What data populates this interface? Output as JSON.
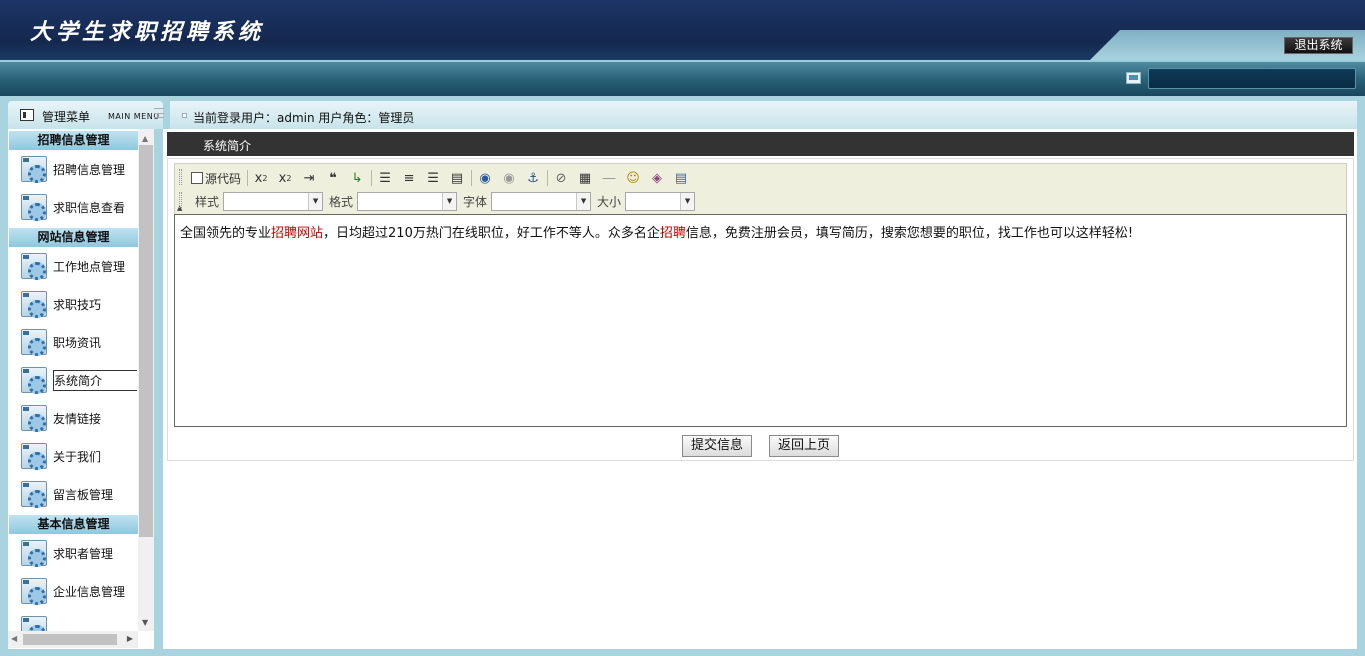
{
  "header": {
    "app_title": "大学生求职招聘系统",
    "logout_label": "退出系统"
  },
  "menu": {
    "title": "管理菜单",
    "subtitle": "MAIN MENU",
    "groups": [
      {
        "title": "招聘信息管理",
        "items": [
          {
            "label": "招聘信息管理",
            "icon": "gear-icon"
          },
          {
            "label": "求职信息查看",
            "icon": "gear-icon"
          }
        ]
      },
      {
        "title": "网站信息管理",
        "items": [
          {
            "label": "工作地点管理",
            "icon": "gear-icon"
          },
          {
            "label": "求职技巧",
            "icon": "gear-icon"
          },
          {
            "label": "职场资讯",
            "icon": "gear-icon"
          },
          {
            "label": "系统简介",
            "icon": "gear-icon",
            "active": true
          },
          {
            "label": "友情链接",
            "icon": "gear-icon"
          },
          {
            "label": "关于我们",
            "icon": "gear-icon"
          },
          {
            "label": "留言板管理",
            "icon": "gear-icon"
          }
        ]
      },
      {
        "title": "基本信息管理",
        "items": [
          {
            "label": "求职者管理",
            "icon": "gear-icon"
          },
          {
            "label": "企业信息管理",
            "icon": "gear-icon"
          }
        ]
      }
    ]
  },
  "userbar": {
    "text": "当前登录用户：admin  用户角色：管理员"
  },
  "page": {
    "section_title": "系统简介"
  },
  "editor": {
    "source_label": "源代码",
    "style_label": "样式",
    "format_label": "格式",
    "font_label": "字体",
    "size_label": "大小",
    "toolbar_icons": [
      "subscript-icon",
      "superscript-icon",
      "indent-icon",
      "blockquote-icon",
      "div-icon",
      "align-left-icon",
      "align-center-icon",
      "align-right-icon",
      "align-justify-icon",
      "link-icon",
      "unlink-icon",
      "anchor-icon",
      "flash-icon",
      "table-icon",
      "horizontal-rule-icon",
      "smiley-icon",
      "special-char-icon",
      "page-break-icon"
    ],
    "content": {
      "part1": "全国领先的专业",
      "link1": "招聘网站",
      "part2": "，日均超过210万热门在线职位，好工作不等人。众多名企",
      "link2": "招聘",
      "part3": "信息，免费注册会员，填写简历，搜索您想要的职位，找工作也可以这样轻松!"
    }
  },
  "buttons": {
    "submit": "提交信息",
    "back": "返回上页"
  },
  "colors": {
    "header": "#14284f",
    "frame": "#a9d3de",
    "title_bar": "#333333",
    "link_highlight": "#c00000"
  }
}
